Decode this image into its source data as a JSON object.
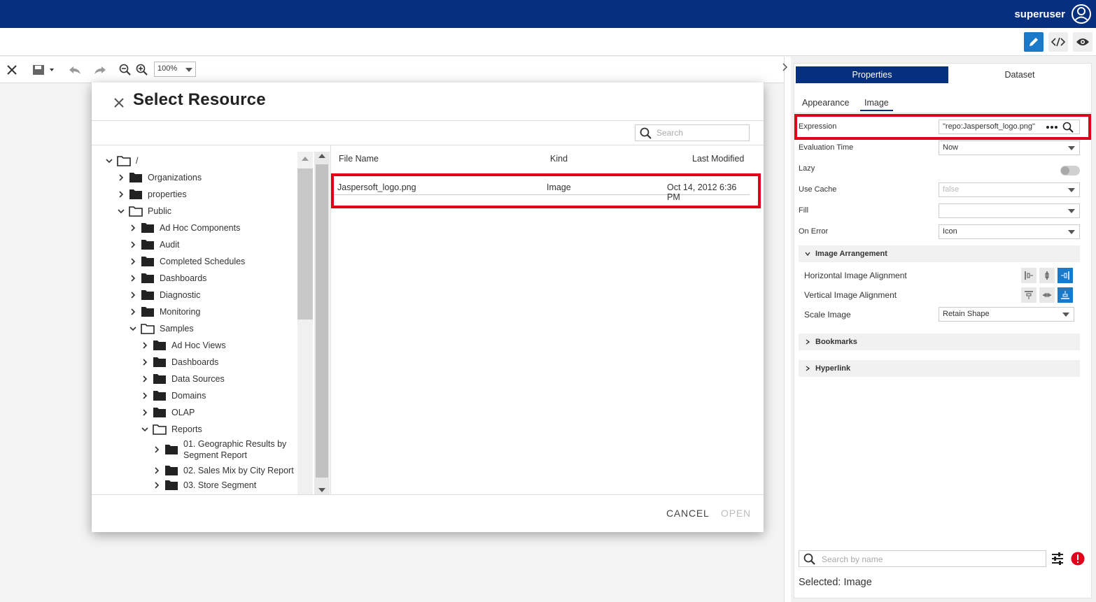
{
  "header": {
    "username": "superuser"
  },
  "toolbar": {
    "zoom": "100%"
  },
  "dialog": {
    "title": "Select Resource",
    "search_placeholder": "Search",
    "tree": {
      "root": "/",
      "items": [
        "Organizations",
        "properties",
        "Public",
        "Ad Hoc Components",
        "Audit",
        "Completed Schedules",
        "Dashboards",
        "Diagnostic",
        "Monitoring",
        "Samples",
        "Ad Hoc Views",
        "Dashboards",
        "Data Sources",
        "Domains",
        "OLAP",
        "Reports",
        "01. Geographic Results by Segment Report",
        "02. Sales Mix by City Report",
        "03. Store Segment"
      ]
    },
    "columns": {
      "file_name": "File Name",
      "kind": "Kind",
      "last_modified": "Last Modified"
    },
    "files": [
      {
        "name": "Jaspersoft_logo.png",
        "kind": "Image",
        "modified": "Oct 14, 2012 6:36 PM"
      }
    ],
    "cancel": "CANCEL",
    "open": "OPEN"
  },
  "panel": {
    "tabs": [
      "Properties",
      "Dataset"
    ],
    "subtabs": [
      "Appearance",
      "Image"
    ],
    "fields": {
      "expression_label": "Expression",
      "expression_value": "\"repo:Jaspersoft_logo.png\"",
      "evaluation_time_label": "Evaluation Time",
      "evaluation_time_value": "Now",
      "lazy_label": "Lazy",
      "use_cache_label": "Use Cache",
      "use_cache_value": "false",
      "fill_label": "Fill",
      "fill_value": "",
      "on_error_label": "On Error",
      "on_error_value": "Icon"
    },
    "image_arrangement": {
      "title": "Image Arrangement",
      "horizontal_label": "Horizontal Image Alignment",
      "vertical_label": "Vertical Image Alignment",
      "scale_label": "Scale Image",
      "scale_value": "Retain Shape"
    },
    "bookmarks": "Bookmarks",
    "hyperlink": "Hyperlink",
    "search_placeholder": "Search by name",
    "selected": "Selected: Image"
  },
  "colors": {
    "brand": "#062f7f",
    "accent": "#1b79c9",
    "highlight": "#e1001a",
    "error": "#e1001a"
  }
}
